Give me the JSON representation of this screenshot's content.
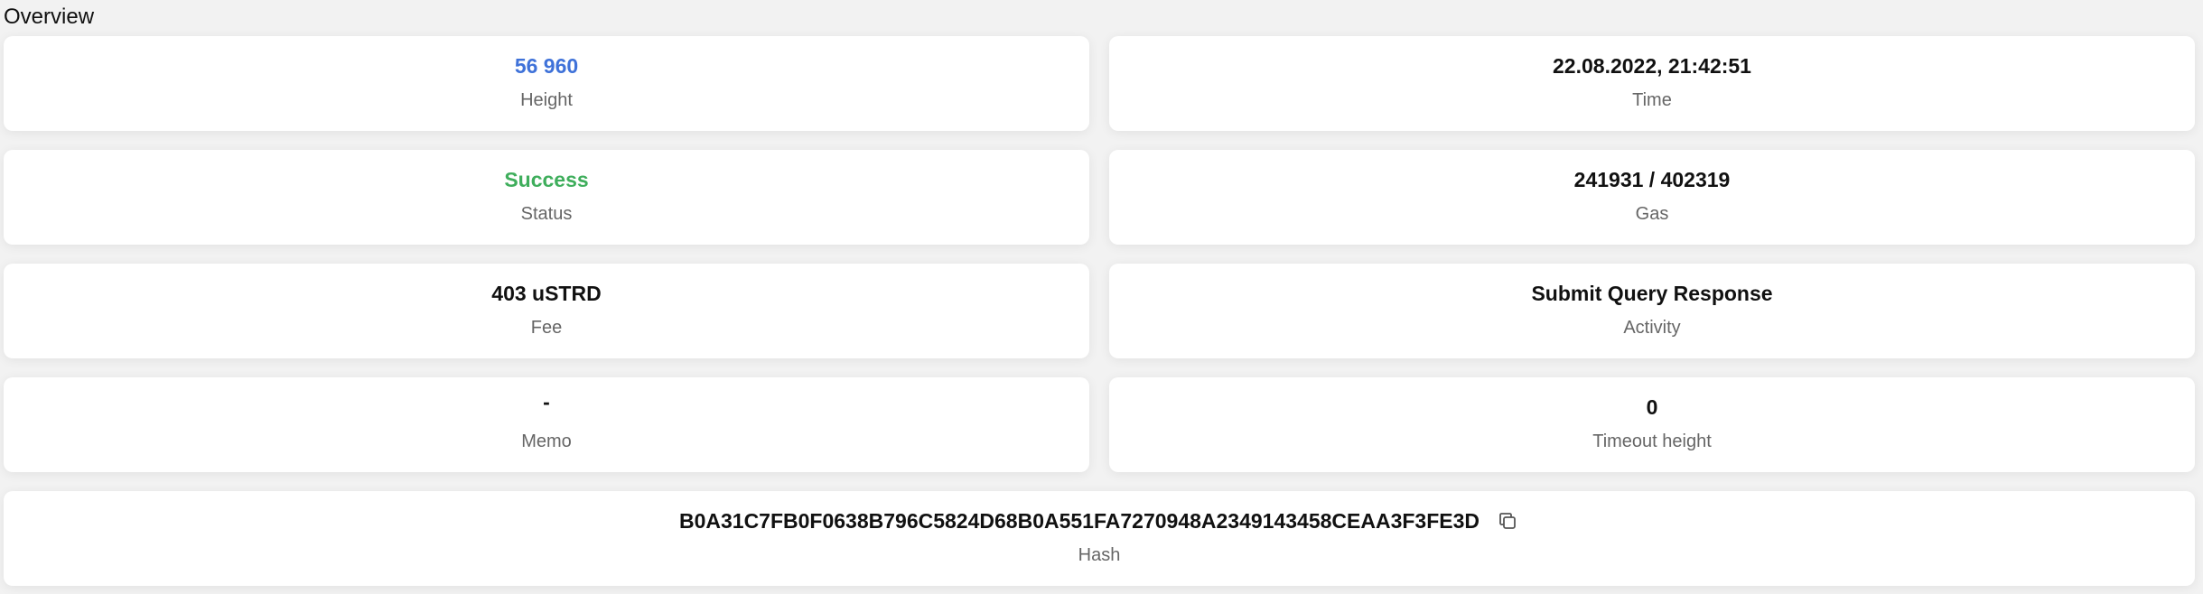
{
  "section": {
    "title": "Overview"
  },
  "cards": {
    "height": {
      "value": "56 960",
      "label": "Height"
    },
    "time": {
      "value": "22.08.2022, 21:42:51",
      "label": "Time"
    },
    "status": {
      "value": "Success",
      "label": "Status"
    },
    "gas": {
      "value": "241931 / 402319",
      "label": "Gas"
    },
    "fee": {
      "value": "403 uSTRD",
      "label": "Fee"
    },
    "activity": {
      "value": "Submit Query Response",
      "label": "Activity"
    },
    "memo": {
      "value": "-",
      "label": "Memo"
    },
    "timeout_height": {
      "value": "0",
      "label": "Timeout height"
    },
    "hash": {
      "value": "B0A31C7FB0F0638B796C5824D68B0A551FA7270948A2349143458CEAA3F3FE3D",
      "label": "Hash",
      "copy_icon": "copy-icon"
    }
  },
  "colors": {
    "height_value": "#3f72d9",
    "status_success": "#3fae5c",
    "background": "#f2f2f2",
    "card": "#ffffff",
    "label": "#666666"
  }
}
